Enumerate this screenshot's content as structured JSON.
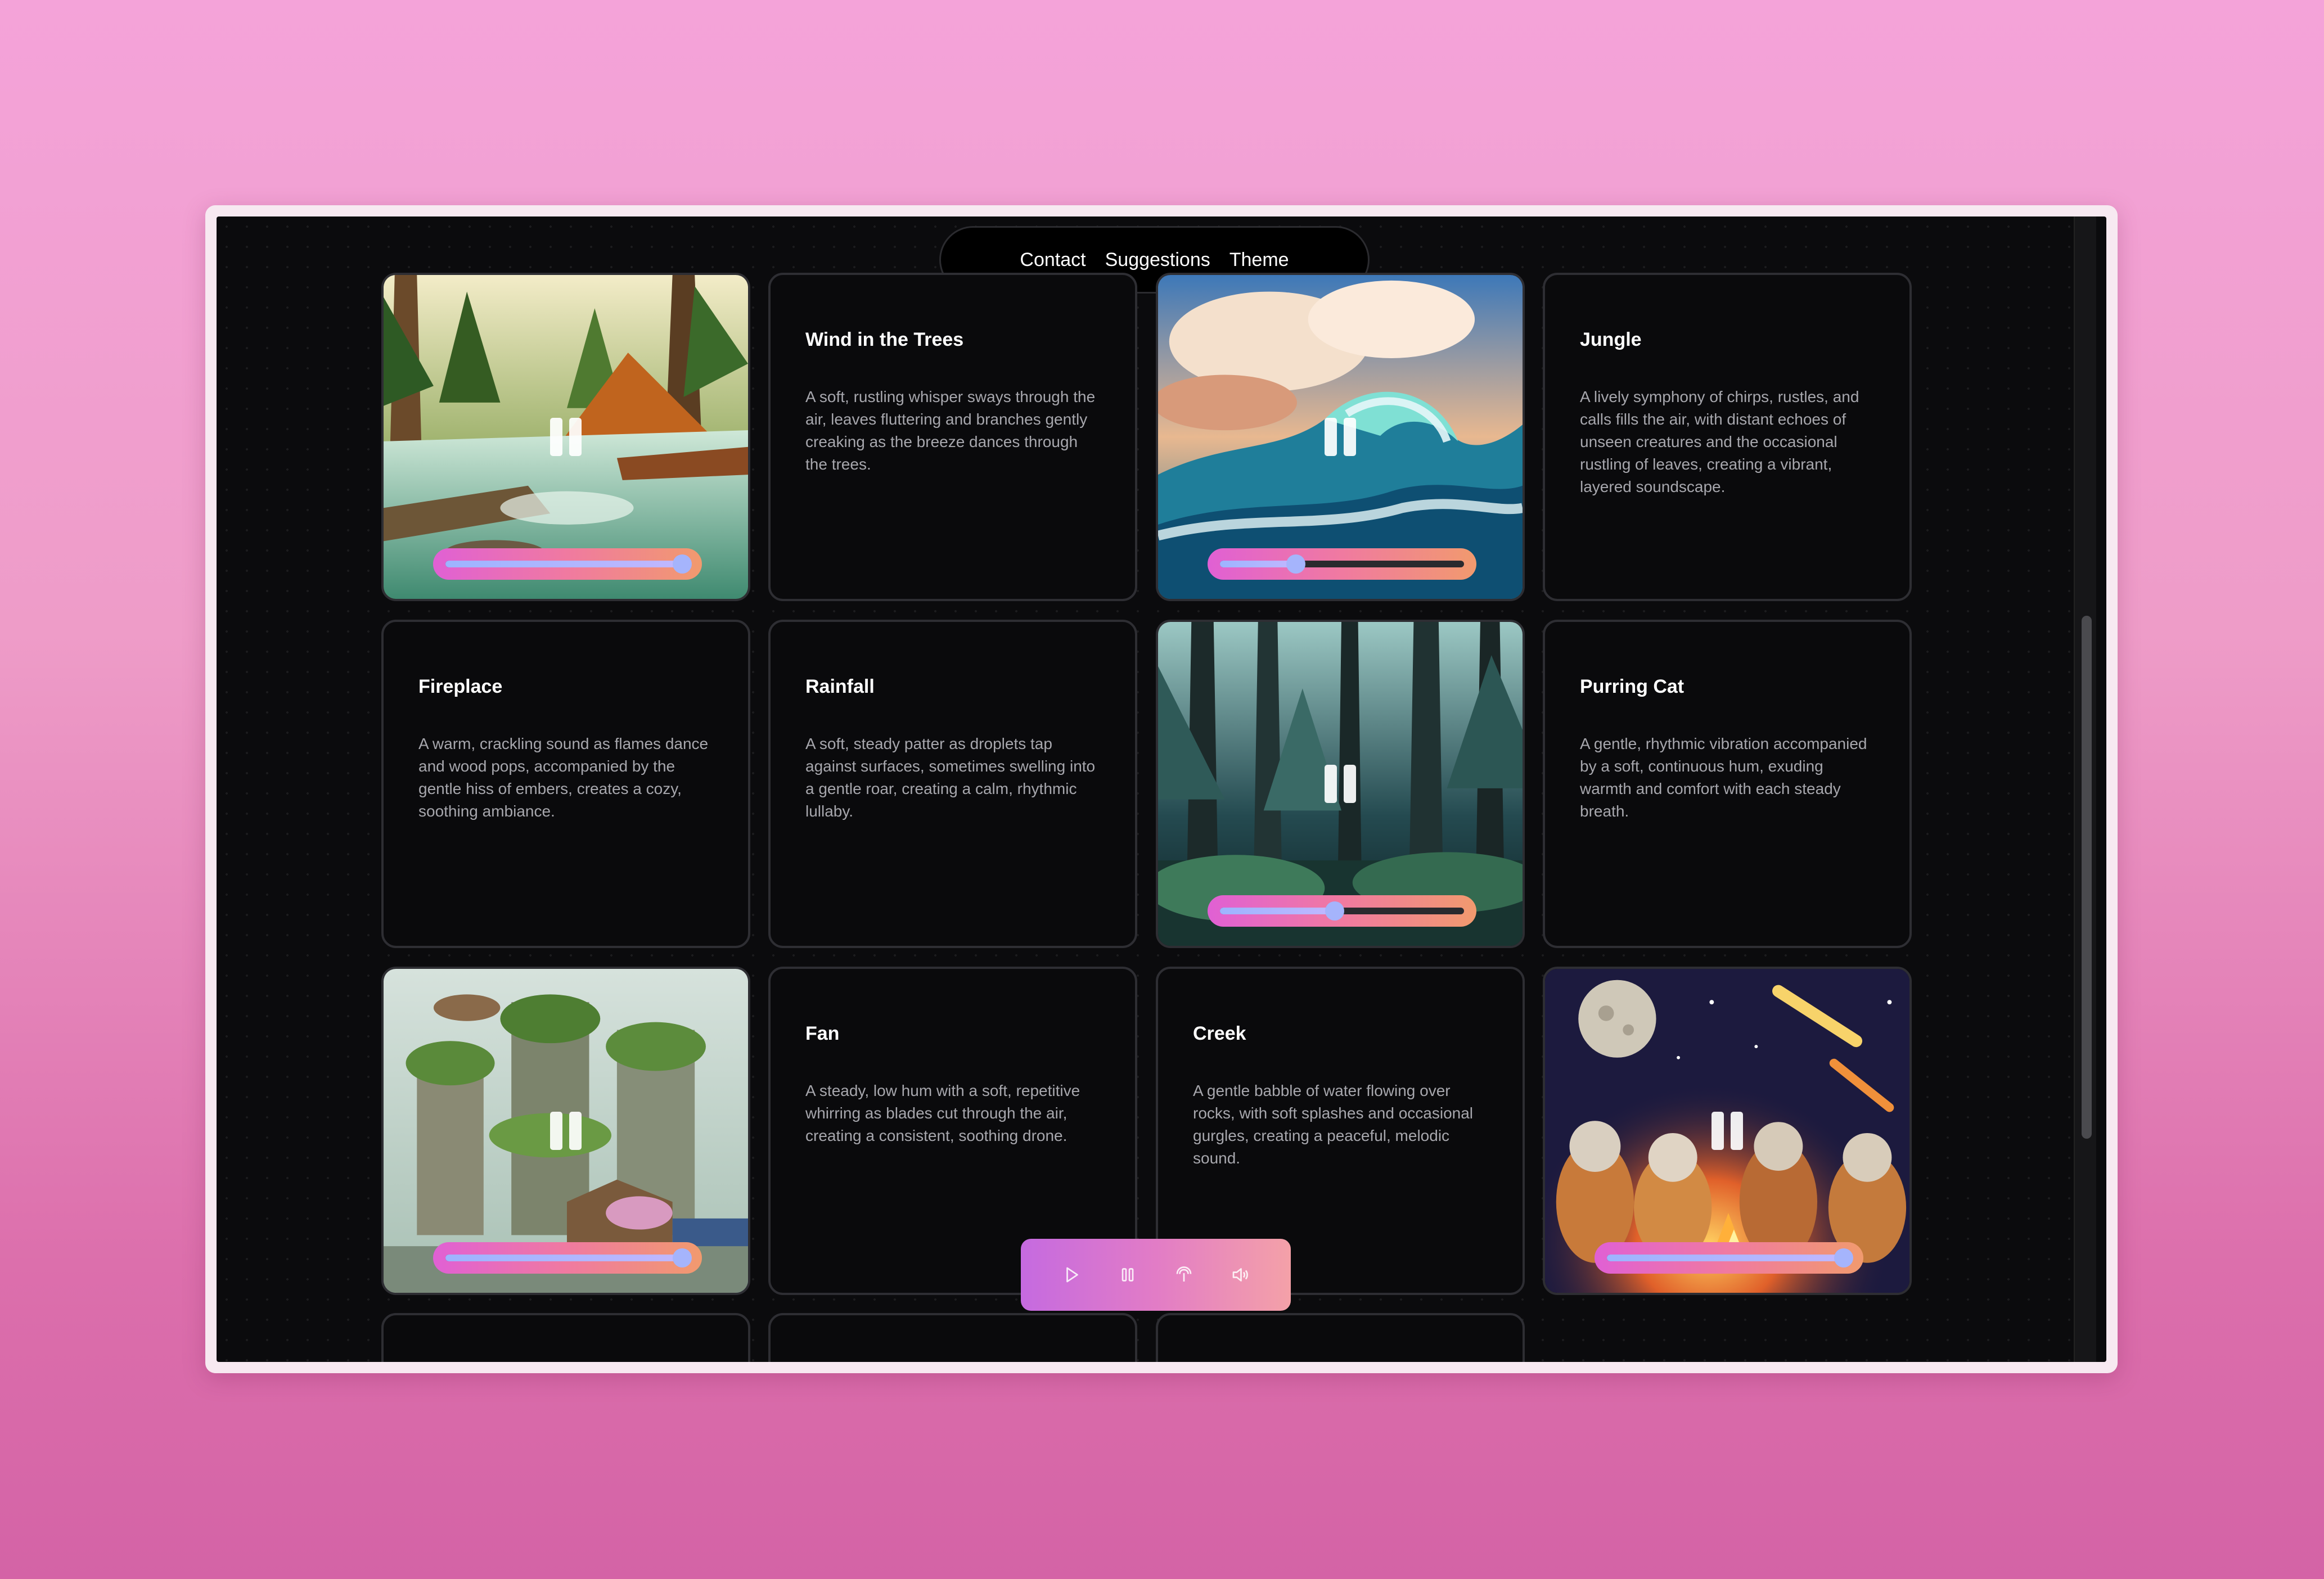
{
  "nav": {
    "items": [
      "Contact",
      "Suggestions",
      "Theme"
    ]
  },
  "cards": {
    "wind": {
      "title": "Wind in the Trees",
      "description": "A soft, rustling whisper sways through the air, leaves fluttering and branches gently creaking as the breeze dances through the trees."
    },
    "jungle": {
      "title": "Jungle",
      "description": "A lively symphony of chirps, rustles, and calls fills the air, with distant echoes of unseen creatures and the occasional rustling of leaves, creating a vibrant, layered soundscape."
    },
    "fireplace": {
      "title": "Fireplace",
      "description": "A warm, crackling sound as flames dance and wood pops, accompanied by the gentle hiss of embers, creates a cozy, soothing ambiance."
    },
    "rainfall": {
      "title": "Rainfall",
      "description": "A soft, steady patter as droplets tap against surfaces, sometimes swelling into a gentle roar, creating a calm, rhythmic lullaby."
    },
    "cat": {
      "title": "Purring Cat",
      "description": "A gentle, rhythmic vibration accompanied by a soft, continuous hum, exuding warmth and comfort with each steady breath."
    },
    "fan": {
      "title": "Fan",
      "description": "A steady, low hum with a soft, repetitive whirring as blades cut through the air, creating a consistent, soothing drone."
    },
    "creek": {
      "title": "Creek",
      "description": "A gentle babble of water flowing over rocks, with soft splashes and occasional gurgles, creating a peaceful, melodic sound."
    }
  },
  "volumes": {
    "river": 0.97,
    "waves": 0.31,
    "forest": 0.47,
    "city": 0.97,
    "campfire": 0.97
  },
  "player": {
    "controls": [
      "play-icon",
      "pause-icon",
      "broadcast-icon",
      "volume-icon"
    ]
  },
  "colors": {
    "accent_start": "#e060d4",
    "accent_end": "#f19a6e",
    "slider_fill": "#9db4ff",
    "background": "#0b0b0d"
  }
}
